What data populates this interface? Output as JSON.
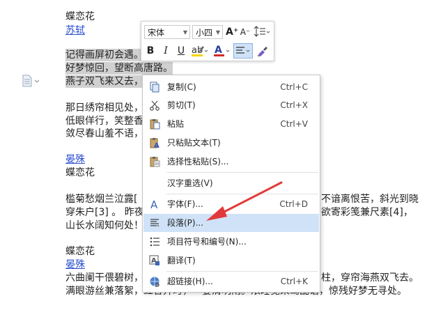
{
  "document": {
    "lines": [
      {
        "text": "蝶恋花",
        "link": false,
        "hl": false
      },
      {
        "text": "苏轼",
        "link": true,
        "hl": false
      },
      {
        "text": "记得画屏初会遇。",
        "link": false,
        "hl": true
      },
      {
        "text": "好梦惊回，望断高唐路。",
        "link": false,
        "hl": true
      },
      {
        "text": "燕子双飞来又去，",
        "link": false,
        "hl": true
      },
      {
        "text": "那日绣帘相见处，",
        "link": false,
        "hl": false
      },
      {
        "text": "低眼佯行，笑整香",
        "link": false,
        "hl": false
      },
      {
        "text": "敛尽春山羞不语，",
        "link": false,
        "hl": false
      },
      {
        "text": "晏殊",
        "link": true,
        "hl": false
      },
      {
        "text": "蝶恋花",
        "link": false,
        "hl": false
      },
      {
        "text": "槛菊愁烟兰泣露[",
        "link": false,
        "hl": false
      },
      {
        "text": "穿朱户[3] 。 昨夜",
        "link": false,
        "hl": false
      },
      {
        "text": "山长水阔知何处！",
        "link": false,
        "hl": false
      },
      {
        "text": "蝶恋花",
        "link": false,
        "hl": false
      },
      {
        "text": "晏殊",
        "link": true,
        "hl": false
      },
      {
        "text": "六曲阑干偎碧树，",
        "link": false,
        "hl": false
      },
      {
        "text": "满眼游丝兼落絮，红杏开时，一霎清明雨。浓睡觉来莺乱语，惊残好梦无寻处。",
        "link": false,
        "hl": false
      }
    ],
    "right_fragments": [
      "不谙离恨苦，斜光到晓",
      "欲寄彩笺兼尺素[4]，",
      "柱，穿帘海燕双飞去。"
    ]
  },
  "toolbar": {
    "font_name": "宋体",
    "font_size": "小四",
    "grow_font": "A⁺",
    "shrink_font": "A⁻",
    "bold": "B",
    "italic": "I",
    "underline": "U",
    "font_color_glyph": "A",
    "highlight_color": "#f4d400",
    "font_color": "#d42b2b"
  },
  "menu": {
    "items": [
      {
        "label": "复制(C)",
        "shortcut": "Ctrl+C",
        "icon": "copy-icon"
      },
      {
        "label": "剪切(T)",
        "shortcut": "Ctrl+X",
        "icon": "scissors-icon"
      },
      {
        "label": "粘贴",
        "shortcut": "Ctrl+V",
        "icon": "paste-icon"
      },
      {
        "label": "只粘贴文本(T)",
        "shortcut": "",
        "icon": "paste-text-icon"
      },
      {
        "label": "选择性粘贴(S)...",
        "shortcut": "",
        "icon": "paste-special-icon"
      },
      {
        "label": "汉字重选(V)",
        "shortcut": "",
        "icon": ""
      },
      {
        "label": "字体(F)...",
        "shortcut": "Ctrl+D",
        "icon": "font-icon"
      },
      {
        "label": "段落(P)...",
        "shortcut": "",
        "icon": "paragraph-icon"
      },
      {
        "label": "项目符号和编号(N)...",
        "shortcut": "",
        "icon": "bullets-icon"
      },
      {
        "label": "翻译(T)",
        "shortcut": "",
        "icon": "translate-icon"
      },
      {
        "label": "超链接(H)...",
        "shortcut": "Ctrl+K",
        "icon": "hyperlink-icon"
      }
    ]
  },
  "annotation": {
    "arrow_color": "#e23a3a"
  }
}
